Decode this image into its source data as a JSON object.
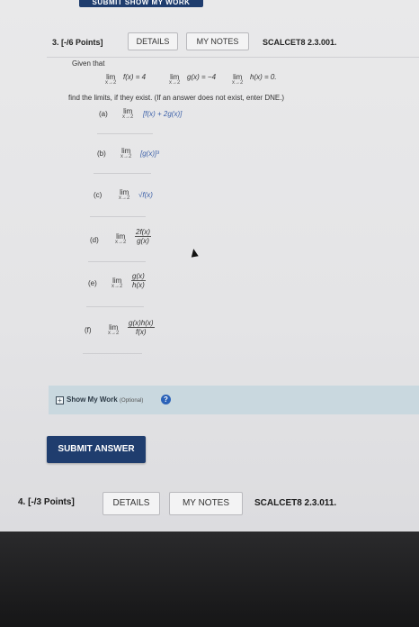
{
  "top_button": {
    "label": "SUBMIT SHOW MY WORK"
  },
  "question3": {
    "number": "3. [-/6 Points]",
    "details_label": "DETAILS",
    "notes_label": "MY NOTES",
    "code": "SCALCET8 2.3.001.",
    "given": "Given that",
    "conditions": [
      {
        "lim": "lim",
        "sub": "x→2",
        "expr": "f(x) = 4"
      },
      {
        "lim": "lim",
        "sub": "x→2",
        "expr": "g(x) = −4"
      },
      {
        "lim": "lim",
        "sub": "x→2",
        "expr": "h(x) = 0."
      }
    ],
    "instruction": "find the limits, if they exist. (If an answer does not exist, enter DNE.)",
    "parts": [
      {
        "label": "(a)",
        "lim": "lim",
        "sub": "x→2",
        "expr": "[f(x) + 2g(x)]"
      },
      {
        "label": "(b)",
        "lim": "lim",
        "sub": "x→2",
        "expr": "[g(x)]³"
      },
      {
        "label": "(c)",
        "lim": "lim",
        "sub": "x→2",
        "expr": "√f(x)"
      },
      {
        "label": "(d)",
        "lim": "lim",
        "sub": "x→2",
        "num": "2f(x)",
        "den": "g(x)"
      },
      {
        "label": "(e)",
        "lim": "lim",
        "sub": "x→2",
        "num": "g(x)",
        "den": "h(x)"
      },
      {
        "label": "(f)",
        "lim": "lim",
        "sub": "x→2",
        "num": "g(x)h(x)",
        "den": "f(x)"
      }
    ],
    "show_work": {
      "label": "Show My Work",
      "optional": "(Optional)",
      "help": "?"
    },
    "submit_label": "SUBMIT ANSWER"
  },
  "question4": {
    "number": "4. [-/3 Points]",
    "details_label": "DETAILS",
    "notes_label": "MY NOTES",
    "code": "SCALCET8 2.3.011."
  }
}
